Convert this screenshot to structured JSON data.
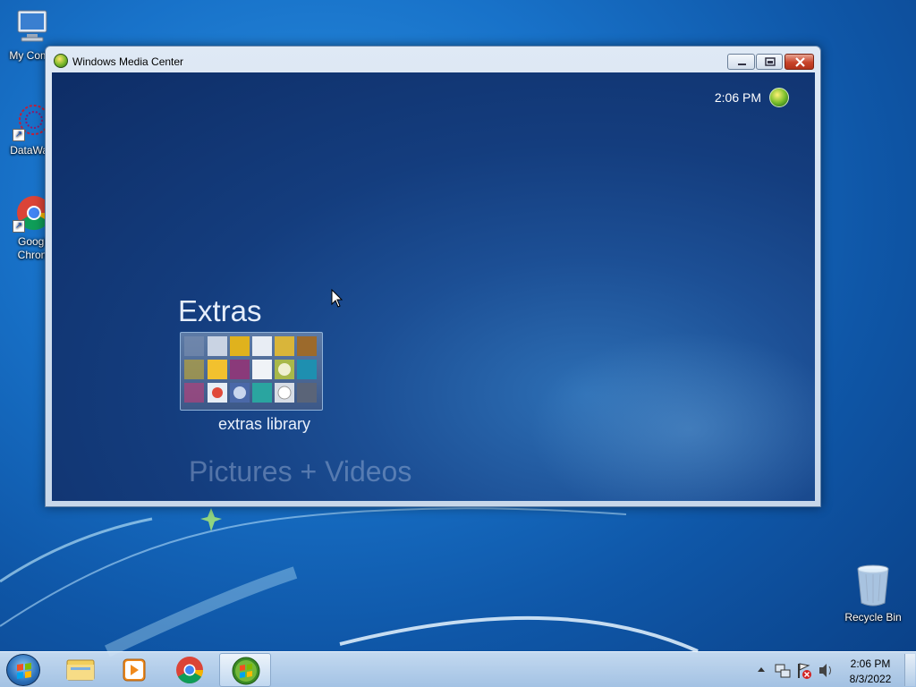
{
  "desktop": {
    "icons": [
      {
        "label": "My Comp",
        "icon": "computer-icon"
      },
      {
        "label": "DataWag",
        "icon": "datawagon-icon"
      },
      {
        "label": "Googl\nChron",
        "icon": "chrome-icon"
      }
    ],
    "recycle_bin_label": "Recycle Bin"
  },
  "window": {
    "title": "Windows Media Center",
    "controls": [
      "minimize-icon",
      "restore-icon",
      "close-icon"
    ]
  },
  "media_center": {
    "clock": "2:06 PM",
    "section_title": "Extras",
    "tile_label": "extras library",
    "next_section": "Pictures + Videos",
    "colors": {
      "background": "#143d7e",
      "text": "#e9f0fb"
    }
  },
  "taskbar": {
    "items": [
      "start-orb-icon",
      "explorer-icon",
      "media-player-icon",
      "chrome-icon",
      "media-center-icon"
    ],
    "tray_icons": [
      "show-hidden-icons",
      "network-icon",
      "action-center-icon",
      "volume-icon"
    ],
    "time": "2:06 PM",
    "date": "8/3/2022"
  }
}
